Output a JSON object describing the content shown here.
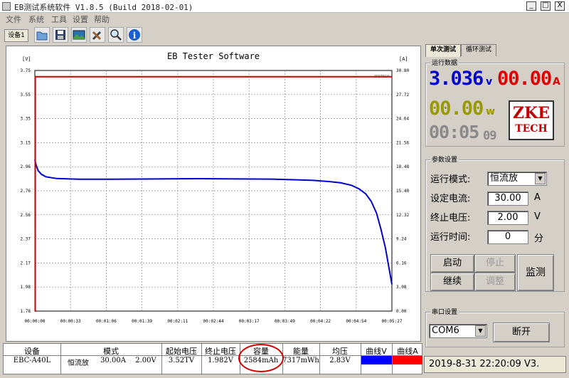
{
  "window": {
    "title": "EB测试系统软件 V1.8.5 (Build 2018-02-01)",
    "minimize": "_",
    "maximize": "□",
    "close": "X"
  },
  "menu": [
    "文件",
    "系统",
    "工具",
    "设置",
    "帮助"
  ],
  "toolbar": {
    "device_tab": "设备1",
    "tools": [
      "open-folder-icon",
      "save-icon",
      "image-icon",
      "tools-icon",
      "zoom-icon",
      "info-icon"
    ]
  },
  "chart_data": {
    "type": "line",
    "title": "EB Tester Software",
    "watermark": "ZKETECH",
    "ylabel_left": "[V]",
    "ylabel_right": "[A]",
    "ylim_left": [
      1.78,
      3.75
    ],
    "ylim_right": [
      0,
      30.8
    ],
    "y_ticks_left": [
      "3.75",
      "3.55",
      "3.35",
      "3.15",
      "2.96",
      "2.76",
      "2.56",
      "2.37",
      "2.17",
      "1.98",
      "1.78"
    ],
    "y_ticks_right": [
      "30.80",
      "27.72",
      "24.64",
      "21.56",
      "18.48",
      "15.40",
      "12.32",
      "9.24",
      "6.16",
      "3.08",
      "0.00"
    ],
    "x_ticks": [
      "00:00:00",
      "00:00:33",
      "00:01:06",
      "00:01:39",
      "00:02:11",
      "00:02:44",
      "00:03:17",
      "00:03:49",
      "00:04:22",
      "00:04:54",
      "00:05:27"
    ],
    "series": [
      {
        "name": "曲线V",
        "color": "#0000cc",
        "axis": "left",
        "points": [
          [
            0,
            3.02
          ],
          [
            1,
            2.98
          ],
          [
            3,
            2.93
          ],
          [
            6,
            2.9
          ],
          [
            10,
            2.88
          ],
          [
            20,
            2.865
          ],
          [
            40,
            2.86
          ],
          [
            70,
            2.86
          ],
          [
            110,
            2.862
          ],
          [
            150,
            2.864
          ],
          [
            190,
            2.862
          ],
          [
            220,
            2.86
          ],
          [
            240,
            2.855
          ],
          [
            255,
            2.85
          ],
          [
            270,
            2.84
          ],
          [
            280,
            2.83
          ],
          [
            290,
            2.81
          ],
          [
            297,
            2.78
          ],
          [
            303,
            2.74
          ],
          [
            308,
            2.68
          ],
          [
            313,
            2.58
          ],
          [
            317,
            2.45
          ],
          [
            321,
            2.3
          ],
          [
            324,
            2.15
          ],
          [
            327,
            2.0
          ]
        ]
      },
      {
        "name": "曲线A",
        "color": "#cc0000",
        "axis": "right",
        "points": [
          [
            0,
            0
          ],
          [
            0.3,
            0
          ],
          [
            0.4,
            30
          ],
          [
            327,
            30
          ]
        ]
      }
    ]
  },
  "right_tabs": [
    "单次测试",
    "循环测试"
  ],
  "run_data": {
    "label": "运行数据",
    "voltage": "3.036",
    "voltage_unit": "v",
    "current": "00.00",
    "current_unit": "A",
    "power": "00.00",
    "power_unit": "w",
    "time_main": "00:05",
    "time_sec": "09",
    "logo_top": "ZKE",
    "logo_bottom": "TECH",
    "color_voltage": "#0000cc",
    "color_current": "#e00000",
    "color_power": "#999900",
    "color_time": "#8a8a8a"
  },
  "params": {
    "label": "参数设置",
    "mode_label": "运行模式:",
    "mode_value": "恒流放",
    "current_label": "设定电流:",
    "current_value": "30.00",
    "current_unit": "A",
    "cutoff_label": "终止电压:",
    "cutoff_value": "2.00",
    "cutoff_unit": "V",
    "runtime_label": "运行时间:",
    "runtime_value": "0",
    "runtime_unit": "分",
    "start": "启动",
    "stop": "停止",
    "continue": "继续",
    "adjust": "调整",
    "monitor": "监测"
  },
  "serial": {
    "label": "串口设置",
    "port": "COM6",
    "disconnect": "断开"
  },
  "table": {
    "headers": [
      "设备",
      "模式",
      "起始电压",
      "终止电压",
      "容量",
      "能量",
      "均压",
      "曲线V",
      "曲线A"
    ],
    "row": [
      "EBC-A40L",
      "恒流放",
      "30.00A",
      "2.00V",
      "3.52TV",
      "1.982V",
      "2584mAh",
      "7317mWh",
      "2.83V"
    ],
    "curve_v_color": "#0000ff",
    "curve_a_color": "#ff0000"
  },
  "status": {
    "datetime": "2019-8-31 22:20:09",
    "version": "V3."
  }
}
